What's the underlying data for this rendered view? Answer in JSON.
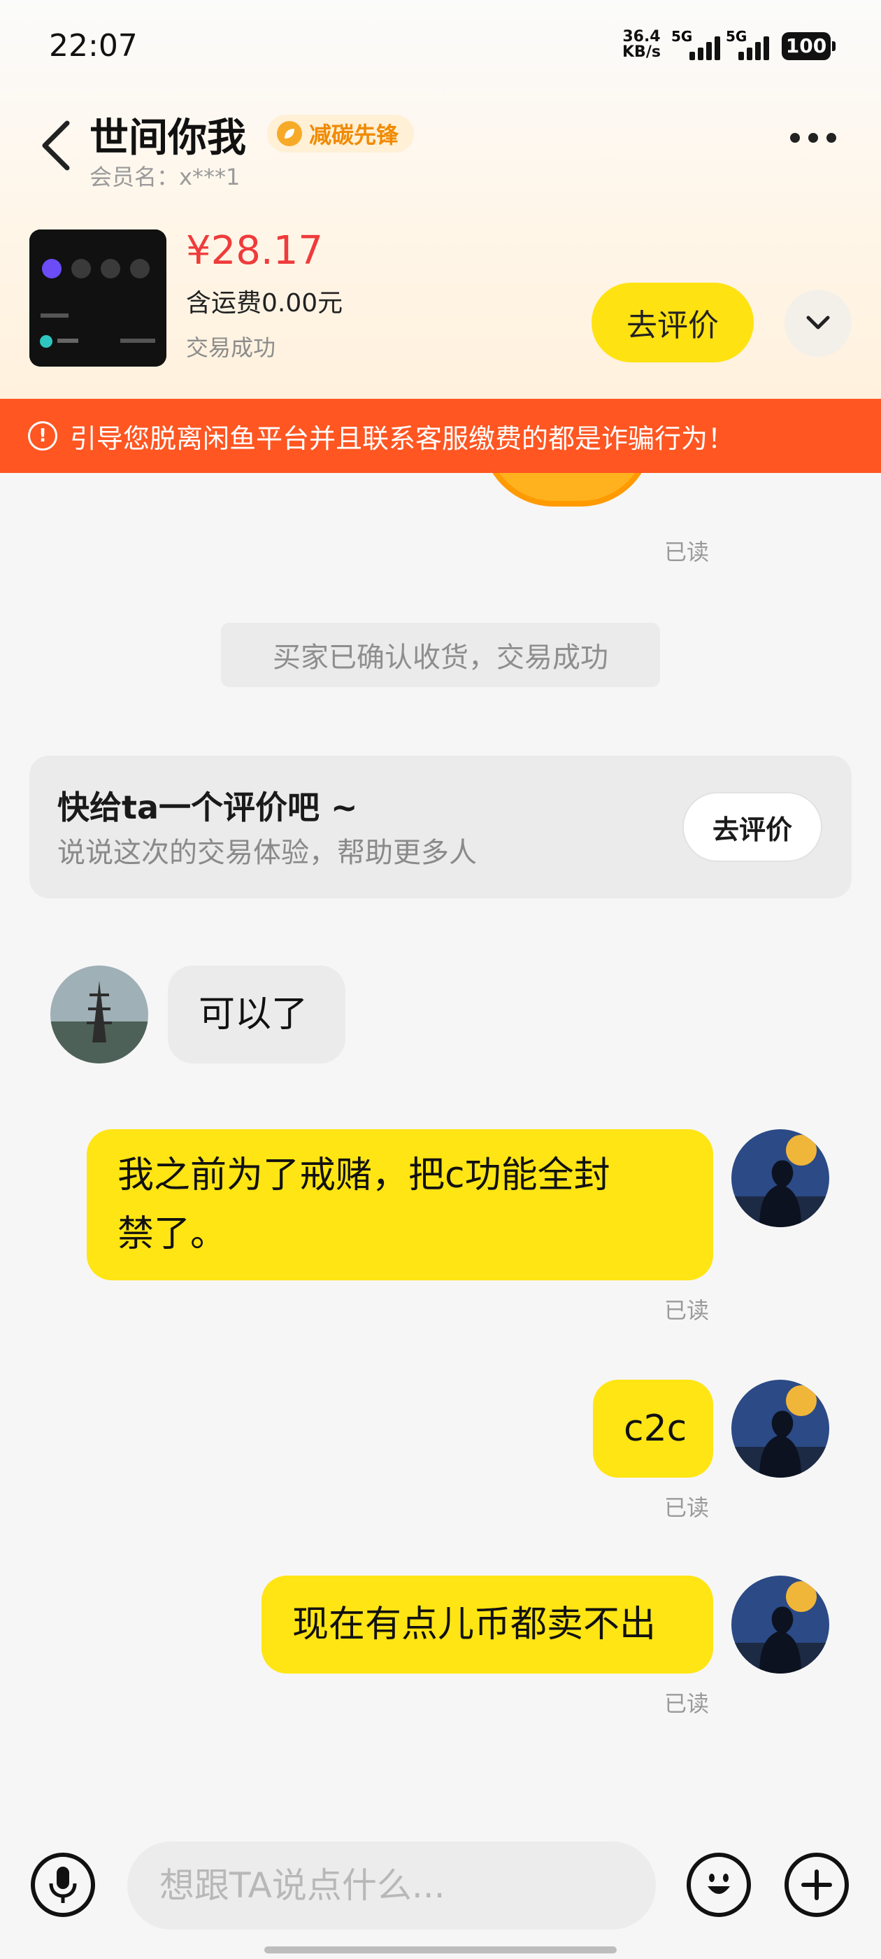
{
  "status_bar": {
    "time": "22:07",
    "net_speed": "36.4",
    "net_unit": "KB/s",
    "sim1": "5G",
    "sim2": "5G",
    "battery": "100"
  },
  "header": {
    "title": "世间你我",
    "badge": "减碳先锋",
    "member": "会员名：x***1"
  },
  "order": {
    "price": "¥28.17",
    "shipping": "含运费0.00元",
    "status": "交易成功",
    "review_button": "去评价"
  },
  "warning": {
    "text": "引导您脱离闲鱼平台并且联系客服缴费的都是诈骗行为！"
  },
  "chat": {
    "read_label": "已读",
    "system_message": "买家已确认收货，交易成功",
    "review_card": {
      "title": "快给ta一个评价吧 ~",
      "subtitle": "说说这次的交易体验，帮助更多人",
      "button": "去评价"
    },
    "messages": [
      {
        "side": "left",
        "text": "可以了"
      },
      {
        "side": "right",
        "text_line1": "我之前为了戒赌，把c功能全封",
        "text_line2": "禁了。"
      },
      {
        "side": "right",
        "text": "c2c"
      },
      {
        "side": "right",
        "text": "现在有点儿币都卖不出"
      }
    ]
  },
  "input_bar": {
    "placeholder": "想跟TA说点什么..."
  },
  "colors": {
    "accent_yellow": "#ffe513",
    "warning_orange": "#ff5622",
    "price_red": "#ef3b3b"
  },
  "icons": [
    "back-arrow-icon",
    "more-icon",
    "chevron-down-icon",
    "alert-icon",
    "voice-icon",
    "emoji-icon",
    "plus-icon",
    "leaf-icon"
  ]
}
